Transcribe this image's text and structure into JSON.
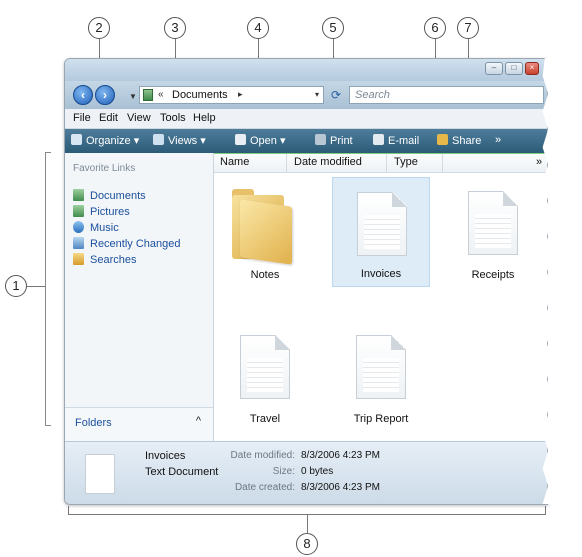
{
  "callouts": [
    "1",
    "2",
    "3",
    "4",
    "5",
    "6",
    "7",
    "8"
  ],
  "address": {
    "chevrons": "«",
    "path": "Documents",
    "path_arrow": "▸",
    "dropdown": "▾",
    "refresh_icon": "refresh-icon"
  },
  "search": {
    "placeholder": "Search"
  },
  "menus": [
    "File",
    "Edit",
    "View",
    "Tools",
    "Help"
  ],
  "toolbar": {
    "organize": "Organize",
    "views": "Views",
    "open": "Open",
    "print": "Print",
    "email": "E-mail",
    "share": "Share",
    "more": "»"
  },
  "nav": {
    "heading": "Favorite Links",
    "items": [
      "Documents",
      "Pictures",
      "Music",
      "Recently Changed",
      "Searches"
    ],
    "folders_label": "Folders",
    "folders_caret": "^"
  },
  "columns": {
    "name": "Name",
    "date": "Date modified",
    "type": "Type",
    "more": "»"
  },
  "files": [
    "Notes",
    "Invoices",
    "Receipts",
    "Travel",
    "Trip Report"
  ],
  "details": {
    "name": "Invoices",
    "type": "Text Document",
    "date_modified_label": "Date modified:",
    "date_modified": "8/3/2006 4:23 PM",
    "size_label": "Size:",
    "size": "0 bytes",
    "date_created_label": "Date created:",
    "date_created": "8/3/2006 4:23 PM"
  },
  "colors": {
    "toolbar": "#2c5b78",
    "link": "#1b4f9c",
    "selection": "#ddecf7"
  }
}
